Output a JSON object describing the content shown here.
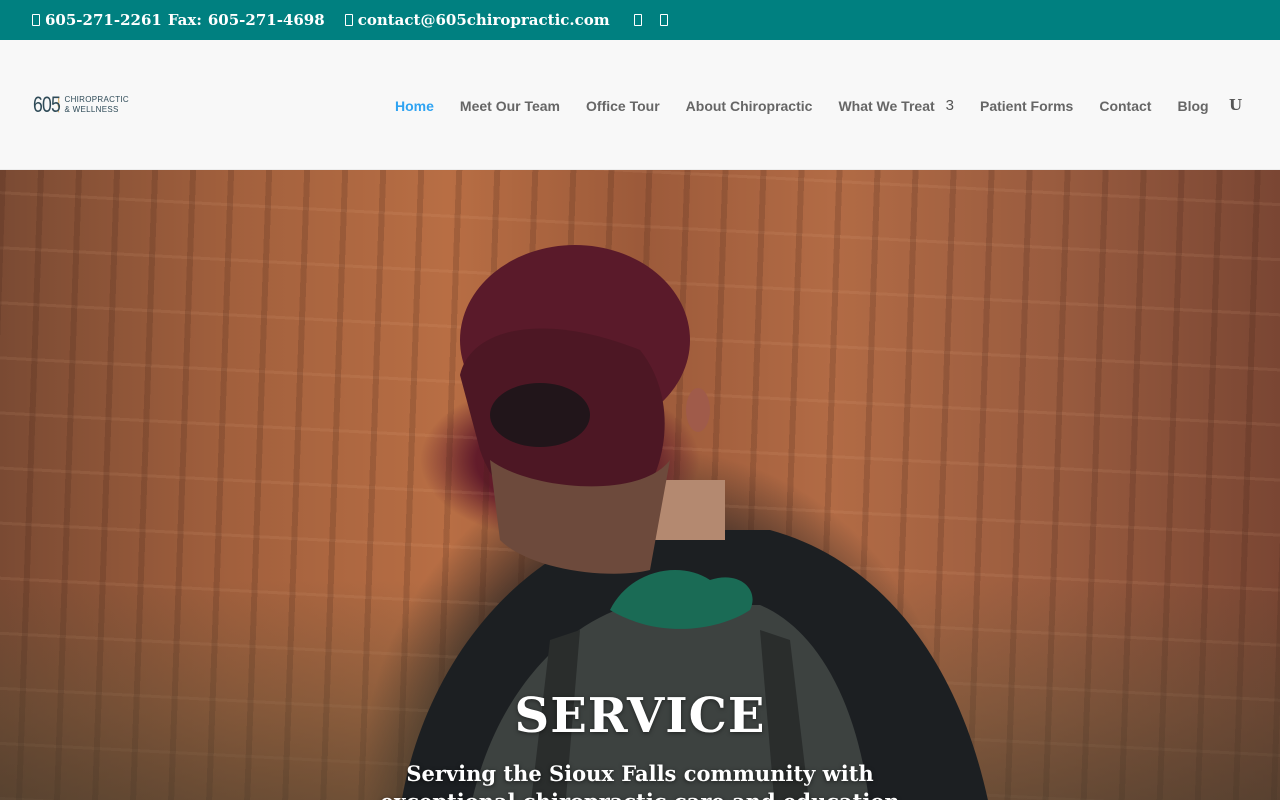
{
  "topbar": {
    "phone": "605-271-2261",
    "fax_label": "Fax:",
    "fax": "605-271-4698",
    "email": "contact@605chiropractic.com",
    "icons": [
      "phone-icon",
      "email-icon",
      "facebook-icon",
      "instagram-icon"
    ]
  },
  "header": {
    "logo": {
      "number": "605",
      "line1": "CHIROPRACTIC",
      "line2": "& WELLNESS"
    },
    "nav": [
      {
        "label": "Home",
        "active": true
      },
      {
        "label": "Meet Our Team"
      },
      {
        "label": "Office Tour"
      },
      {
        "label": "About Chiropractic"
      },
      {
        "label": "What We Treat",
        "dropdown_glyph": "3"
      },
      {
        "label": "Patient Forms"
      },
      {
        "label": "Contact"
      },
      {
        "label": "Blog"
      }
    ],
    "search_glyph": "U"
  },
  "hero": {
    "title": "SERVICE",
    "subtitle_line1": "Serving the Sioux Falls community with",
    "subtitle_line2": "exceptional chiropractic care and education"
  },
  "colors": {
    "topbar_bg": "#008080",
    "header_bg": "#f8f8f8",
    "nav_text": "#666666",
    "nav_active": "#2ea3f2",
    "hero_text": "#ffffff"
  }
}
